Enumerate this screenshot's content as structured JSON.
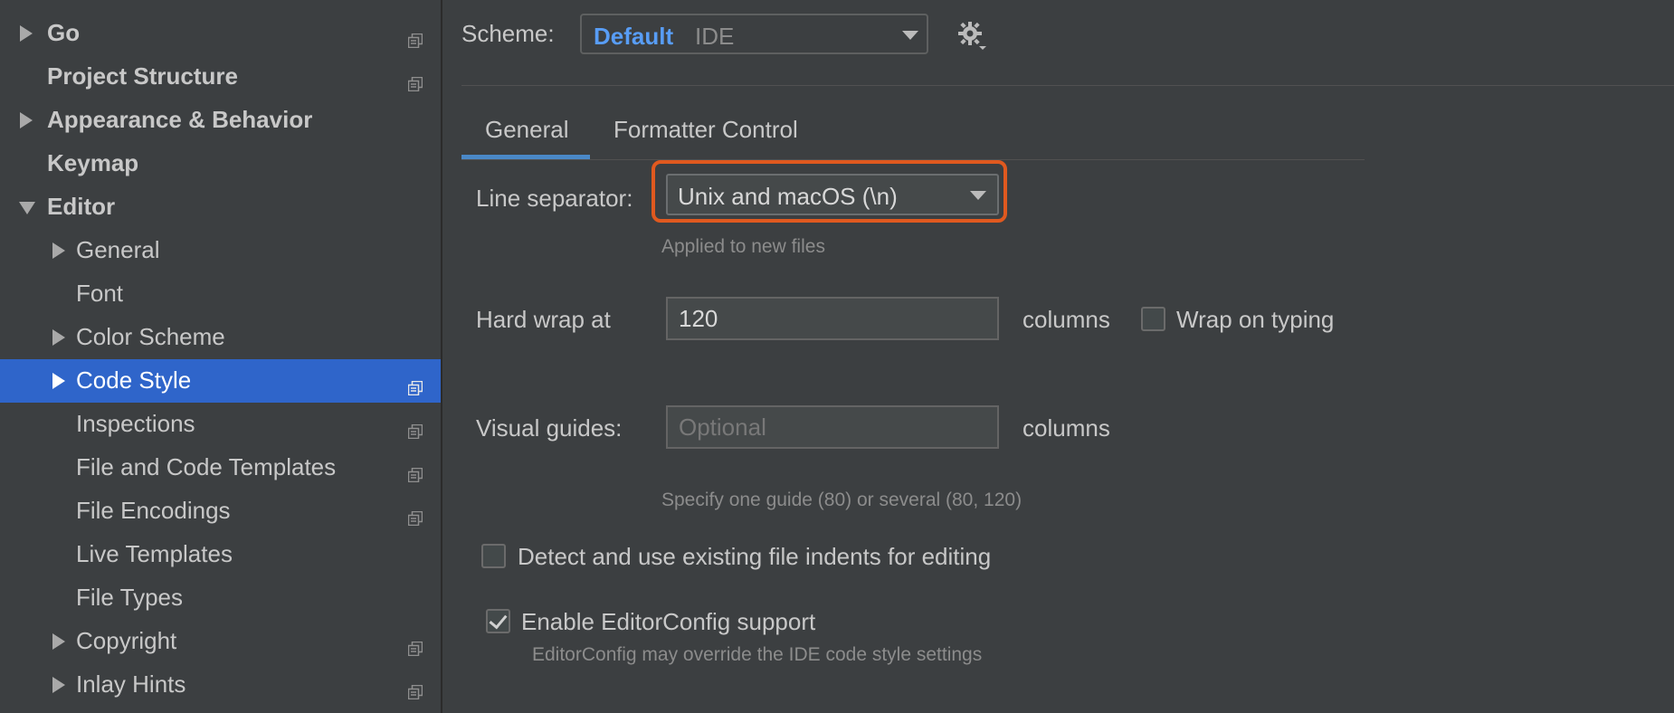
{
  "sidebar": {
    "items": [
      {
        "label": "Go",
        "arrow": "right",
        "copy_icon": true,
        "bold": true,
        "indent": 0
      },
      {
        "label": "Project Structure",
        "arrow": "none",
        "copy_icon": true,
        "bold": true,
        "indent": 0
      },
      {
        "label": "Appearance & Behavior",
        "arrow": "right",
        "copy_icon": false,
        "bold": true,
        "indent": 0
      },
      {
        "label": "Keymap",
        "arrow": "none",
        "copy_icon": false,
        "bold": true,
        "indent": 0
      },
      {
        "label": "Editor",
        "arrow": "down",
        "copy_icon": false,
        "bold": true,
        "indent": 0
      },
      {
        "label": "General",
        "arrow": "right",
        "copy_icon": false,
        "bold": false,
        "indent": 1
      },
      {
        "label": "Font",
        "arrow": "none",
        "copy_icon": false,
        "bold": false,
        "indent": 1
      },
      {
        "label": "Color Scheme",
        "arrow": "right",
        "copy_icon": false,
        "bold": false,
        "indent": 1
      },
      {
        "label": "Code Style",
        "arrow": "right",
        "copy_icon": true,
        "bold": false,
        "indent": 1,
        "selected": true
      },
      {
        "label": "Inspections",
        "arrow": "none",
        "copy_icon": true,
        "bold": false,
        "indent": 1
      },
      {
        "label": "File and Code Templates",
        "arrow": "none",
        "copy_icon": true,
        "bold": false,
        "indent": 1
      },
      {
        "label": "File Encodings",
        "arrow": "none",
        "copy_icon": true,
        "bold": false,
        "indent": 1
      },
      {
        "label": "Live Templates",
        "arrow": "none",
        "copy_icon": false,
        "bold": false,
        "indent": 1
      },
      {
        "label": "File Types",
        "arrow": "none",
        "copy_icon": false,
        "bold": false,
        "indent": 1
      },
      {
        "label": "Copyright",
        "arrow": "right",
        "copy_icon": true,
        "bold": false,
        "indent": 1
      },
      {
        "label": "Inlay Hints",
        "arrow": "right",
        "copy_icon": true,
        "bold": false,
        "indent": 1
      }
    ]
  },
  "scheme": {
    "label": "Scheme:",
    "value_name": "Default",
    "value_type": "IDE",
    "gear_icon": "gear-icon"
  },
  "tabs": [
    {
      "label": "General",
      "active": true
    },
    {
      "label": "Formatter Control",
      "active": false
    }
  ],
  "general": {
    "line_separator_label": "Line separator:",
    "line_separator_value": "Unix and macOS (\\n)",
    "line_separator_hint": "Applied to new files",
    "hard_wrap_label": "Hard wrap at",
    "hard_wrap_value": "120",
    "hard_wrap_unit": "columns",
    "wrap_on_typing_label": "Wrap on typing",
    "wrap_on_typing_checked": false,
    "visual_guides_label": "Visual guides:",
    "visual_guides_placeholder": "Optional",
    "visual_guides_unit": "columns",
    "visual_guides_hint": "Specify one guide (80) or several (80, 120)",
    "detect_indents_label": "Detect and use existing file indents for editing",
    "detect_indents_checked": false,
    "editorconfig_label": "Enable EditorConfig support",
    "editorconfig_checked": true,
    "editorconfig_hint": "EditorConfig may override the IDE code style settings"
  },
  "colors": {
    "selection": "#2f65ca",
    "highlight": "#e0591f",
    "scheme_accent": "#589df6",
    "tab_underline": "#4a88c7"
  }
}
